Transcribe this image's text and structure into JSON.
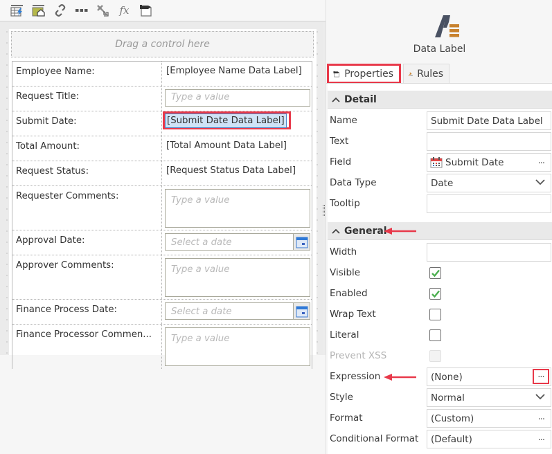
{
  "toolbar": {
    "buttons": [
      {
        "name": "table-edit-icon",
        "tooltip": ""
      },
      {
        "name": "image-edit-icon",
        "tooltip": ""
      },
      {
        "name": "link-icon",
        "tooltip": ""
      },
      {
        "name": "more-icon",
        "tooltip": ""
      },
      {
        "name": "tools-icon",
        "tooltip": ""
      },
      {
        "name": "function-icon",
        "tooltip": "fx"
      },
      {
        "name": "properties-icon",
        "tooltip": ""
      }
    ],
    "fx_label": "fx"
  },
  "designer": {
    "dropzone_text": "Drag a control here",
    "rows": [
      {
        "label": "Employee Name:",
        "type": "datalabel",
        "value": "[Employee Name Data Label]"
      },
      {
        "label": "Request Title:",
        "type": "text",
        "placeholder": "Type a value"
      },
      {
        "label": "Submit Date:",
        "type": "datalabel",
        "value": "[Submit Date Data Label]",
        "selected": true
      },
      {
        "label": "Total Amount:",
        "type": "datalabel",
        "value": "[Total Amount Data Label]"
      },
      {
        "label": "Request Status:",
        "type": "datalabel",
        "value": "[Request Status Data Label]"
      },
      {
        "label": "Requester Comments:",
        "type": "textarea",
        "placeholder": "Type a value"
      },
      {
        "label": "Approval Date:",
        "type": "date",
        "placeholder": "Select a date"
      },
      {
        "label": "Approver Comments:",
        "type": "textarea",
        "placeholder": "Type a value"
      },
      {
        "label": "Finance Process Date:",
        "type": "date",
        "placeholder": "Select a date"
      },
      {
        "label": "Finance Processor Commen...",
        "type": "textarea",
        "placeholder": "Type a value"
      }
    ]
  },
  "properties": {
    "control_type": "Data Label",
    "tabs": [
      {
        "label": "Properties",
        "active": true
      },
      {
        "label": "Rules",
        "active": false
      }
    ],
    "sections": {
      "detail": {
        "title": "Detail",
        "fields": {
          "name": {
            "label": "Name",
            "value": "Submit Date Data Label"
          },
          "text": {
            "label": "Text",
            "value": ""
          },
          "field": {
            "label": "Field",
            "value": "Submit Date",
            "button": "..."
          },
          "data_type": {
            "label": "Data Type",
            "value": "Date"
          },
          "tooltip": {
            "label": "Tooltip",
            "value": ""
          }
        }
      },
      "general": {
        "title": "General",
        "fields": {
          "width": {
            "label": "Width",
            "value": ""
          },
          "visible": {
            "label": "Visible",
            "checked": true
          },
          "enabled": {
            "label": "Enabled",
            "checked": true
          },
          "wrap_text": {
            "label": "Wrap Text",
            "checked": false
          },
          "literal": {
            "label": "Literal",
            "checked": false
          },
          "prevent_xss": {
            "label": "Prevent XSS",
            "checked": false,
            "disabled": true
          },
          "expression": {
            "label": "Expression",
            "value": "(None)",
            "button": "..."
          },
          "style": {
            "label": "Style",
            "value": "Normal"
          },
          "format": {
            "label": "Format",
            "value": "(Custom)",
            "button": "..."
          },
          "conditional_format": {
            "label": "Conditional Format",
            "value": "(Default)",
            "button": "..."
          }
        }
      }
    }
  },
  "colors": {
    "highlight": "#e8394a",
    "check": "#4caf50",
    "selection": "#cfe3f6",
    "icon_dark": "#4a5263",
    "icon_accent": "#c8822e"
  }
}
